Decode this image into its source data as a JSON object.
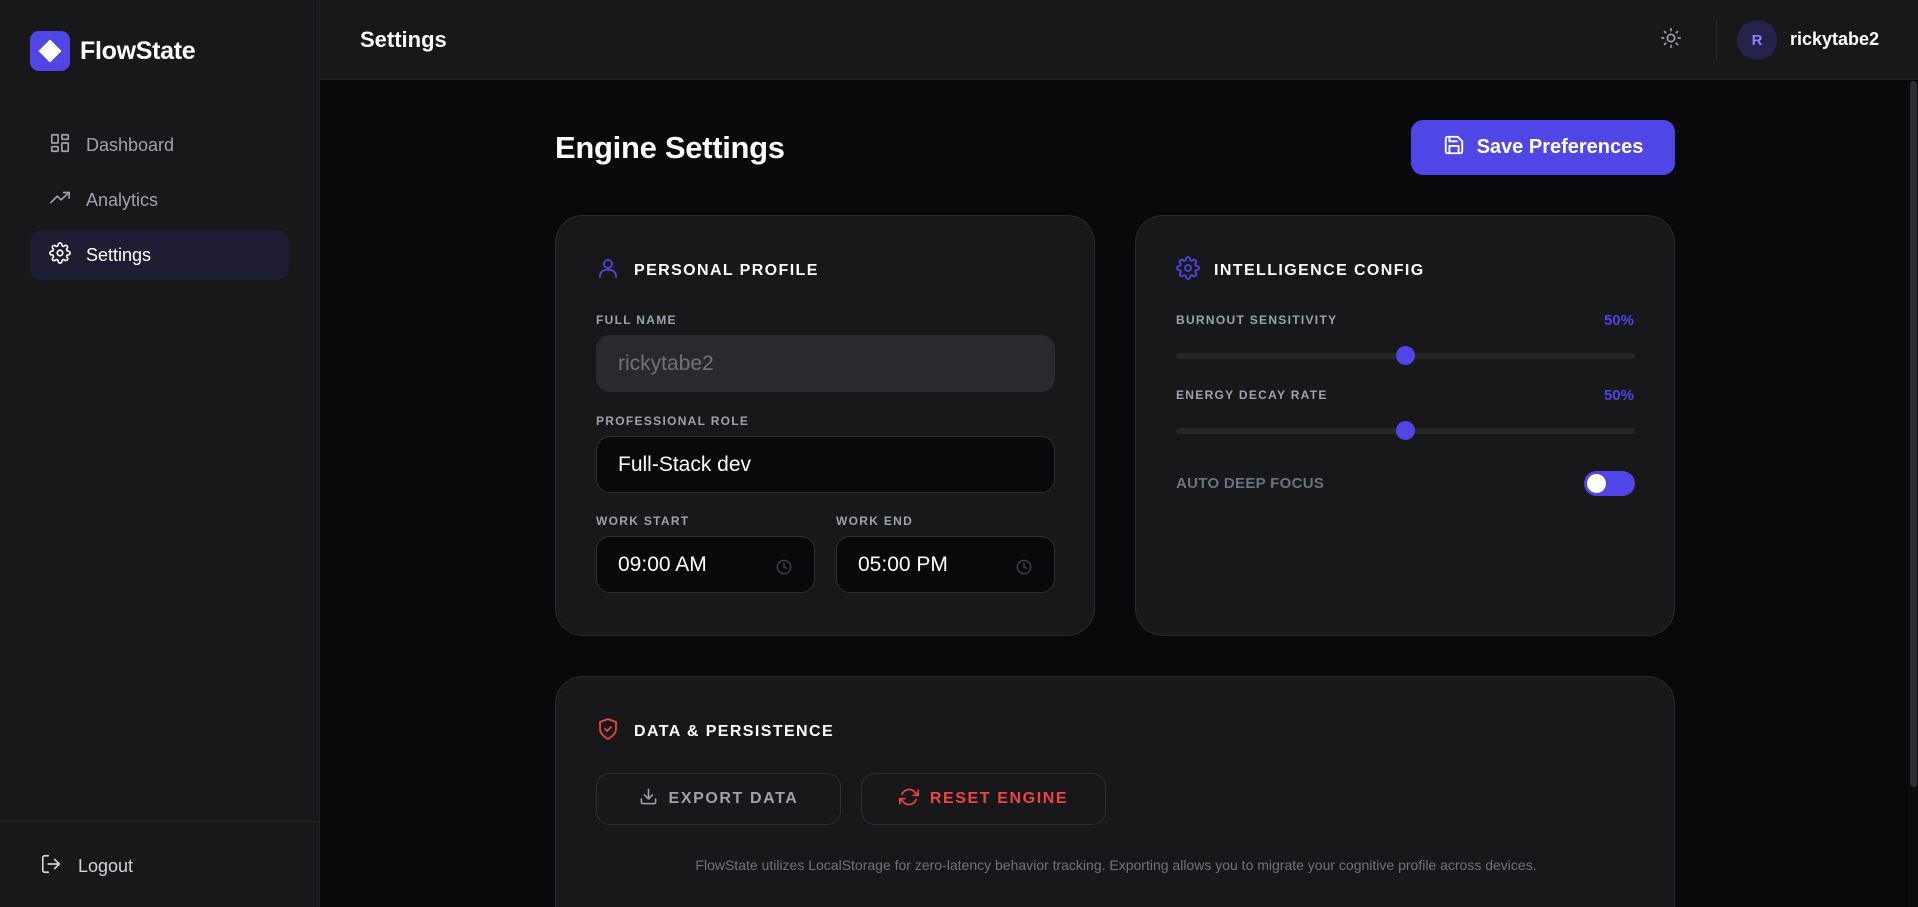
{
  "app": {
    "name": "FlowState",
    "accent": "#5046e5",
    "danger": "#ef4444"
  },
  "sidebar": {
    "items": [
      {
        "label": "Dashboard",
        "icon": "dashboard-grid-icon",
        "active": false
      },
      {
        "label": "Analytics",
        "icon": "trending-up-icon",
        "active": false
      },
      {
        "label": "Settings",
        "icon": "gear-icon",
        "active": true
      }
    ],
    "logout_label": "Logout"
  },
  "header": {
    "title": "Settings",
    "theme_icon": "sun-icon",
    "avatar_initial": "R",
    "username": "rickytabe2"
  },
  "main": {
    "title": "Engine Settings",
    "save_label": "Save Preferences"
  },
  "profile": {
    "title": "PERSONAL PROFILE",
    "full_name_label": "FULL NAME",
    "full_name_value": "rickytabe2",
    "role_label": "PROFESSIONAL ROLE",
    "role_value": "Full-Stack dev",
    "work_start_label": "WORK START",
    "work_start_value": "09:00 AM",
    "work_end_label": "WORK END",
    "work_end_value": "05:00 PM"
  },
  "intelligence": {
    "title": "INTELLIGENCE CONFIG",
    "burnout_label": "BURNOUT SENSITIVITY",
    "burnout_display": "50%",
    "burnout_value": 0.5,
    "decay_label": "ENERGY DECAY RATE",
    "decay_display": "50%",
    "decay_value": 0.5,
    "auto_focus_label": "AUTO DEEP FOCUS",
    "auto_focus_on": true
  },
  "data": {
    "title": "DATA & PERSISTENCE",
    "export_label": "EXPORT DATA",
    "reset_label": "RESET ENGINE",
    "note": "FlowState utilizes LocalStorage for zero-latency behavior tracking. Exporting allows you to migrate your cognitive profile across devices."
  }
}
